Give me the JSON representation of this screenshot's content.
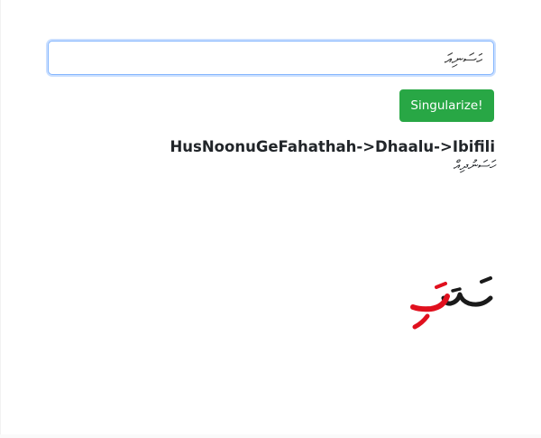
{
  "input": {
    "value": "ހަސަނިއަ"
  },
  "button": {
    "label": "Singularize!"
  },
  "result": {
    "path": "HusNoonuGeFahathah->Dhaalu->Ibifili",
    "word": "ހަސަނުދިއް"
  }
}
